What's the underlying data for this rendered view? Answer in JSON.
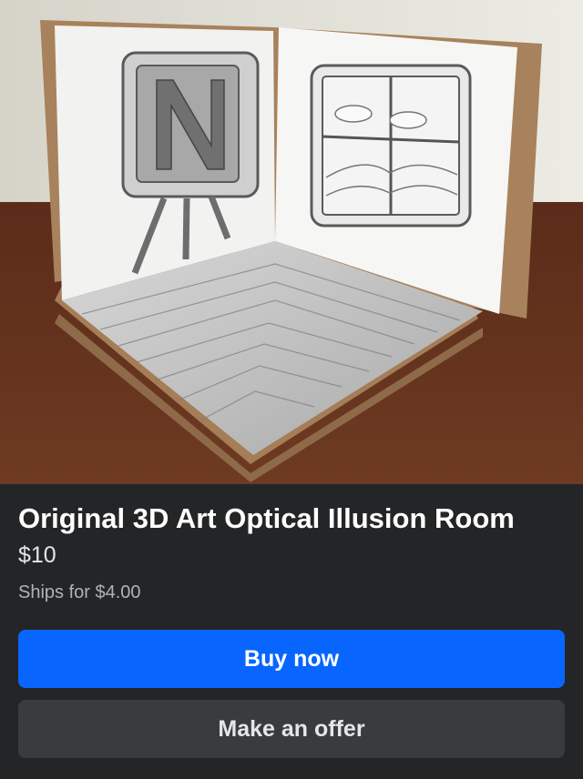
{
  "listing": {
    "photo_description": "Handmade cardboard 3D optical illusion room with pencil-drawn TV, window and striped floor",
    "title": "Original 3D Art Optical Illusion Room",
    "price": "$10",
    "shipping": "Ships for $4.00",
    "buy_label": "Buy now",
    "offer_label": "Make an offer"
  },
  "colors": {
    "background": "#242526",
    "primary_button": "#0866ff",
    "secondary_button": "#3a3b3c",
    "title_text": "#ffffff",
    "muted_text": "#b0b3b8"
  }
}
